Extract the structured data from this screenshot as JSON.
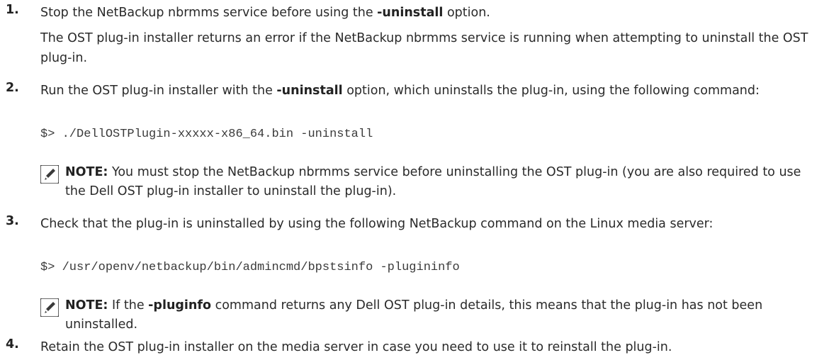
{
  "steps": [
    {
      "number": "1.",
      "text_pre": "Stop the NetBackup nbrmms service before using the ",
      "text_bold": "-uninstall",
      "text_post": " option.",
      "detail": "The OST plug-in installer returns an error if the NetBackup nbrmms service is running when attempting to uninstall the OST plug-in."
    },
    {
      "number": "2.",
      "text_pre": "Run the OST plug-in installer with the ",
      "text_bold": "-uninstall",
      "text_post": " option, which uninstalls the plug-in, using the following command:",
      "command": "$> ./DellOSTPlugin-xxxxx-x86_64.bin -uninstall",
      "note": {
        "icon": "pencil-note-icon",
        "label": "NOTE:",
        "text": " You must stop the NetBackup nbrmms service before uninstalling the OST plug-in (you are also required to use the Dell OST plug-in installer to uninstall the plug-in)."
      }
    },
    {
      "number": "3.",
      "text": "Check that the plug-in is uninstalled by using the following NetBackup command on the Linux media server:",
      "command": "$> /usr/openv/netbackup/bin/admincmd/bpstsinfo -plugininfo",
      "note": {
        "icon": "pencil-note-icon",
        "label": "NOTE:",
        "text_pre": " If the ",
        "text_bold": "-pluginfo",
        "text_post": " command returns any Dell OST plug-in details, this means that the plug-in has not been uninstalled."
      }
    },
    {
      "number": "4.",
      "text": "Retain the OST plug-in installer on the media server in case you need to use it to reinstall the plug-in."
    }
  ],
  "colors": {
    "text": "#2a2a2a",
    "icon": "#3a3a3a"
  }
}
